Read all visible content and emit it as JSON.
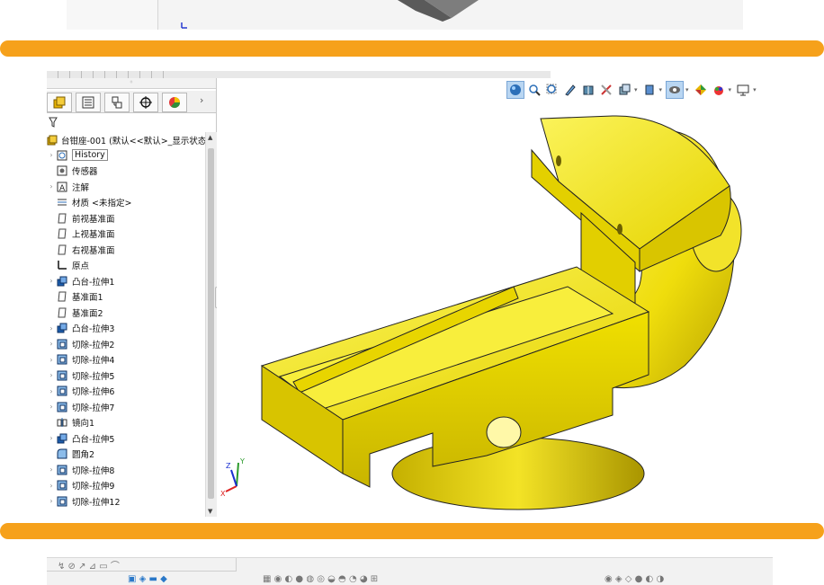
{
  "manager_tabs": [
    "feature-manager",
    "property-manager",
    "configuration-manager",
    "dimxpert-manager",
    "display-manager"
  ],
  "feature_tree": {
    "root": "台钳座-001 (默认<<默认>_显示状态 1",
    "items": [
      {
        "label": "History",
        "icon": "history-icon",
        "expandable": true,
        "boxed": true
      },
      {
        "label": "传感器",
        "icon": "sensor-icon",
        "expandable": false
      },
      {
        "label": "注解",
        "icon": "annotation-icon",
        "expandable": true
      },
      {
        "label": "材质 <未指定>",
        "icon": "material-icon",
        "expandable": false
      },
      {
        "label": "前视基准面",
        "icon": "plane-icon",
        "expandable": false
      },
      {
        "label": "上视基准面",
        "icon": "plane-icon",
        "expandable": false
      },
      {
        "label": "右视基准面",
        "icon": "plane-icon",
        "expandable": false
      },
      {
        "label": "原点",
        "icon": "origin-icon",
        "expandable": false
      },
      {
        "label": "凸台-拉伸1",
        "icon": "extrude-boss-icon",
        "expandable": true
      },
      {
        "label": "基准面1",
        "icon": "plane-icon",
        "expandable": false
      },
      {
        "label": "基准面2",
        "icon": "plane-icon",
        "expandable": false
      },
      {
        "label": "凸台-拉伸3",
        "icon": "extrude-boss-icon",
        "expandable": true
      },
      {
        "label": "切除-拉伸2",
        "icon": "extrude-cut-icon",
        "expandable": true
      },
      {
        "label": "切除-拉伸4",
        "icon": "extrude-cut-icon",
        "expandable": true
      },
      {
        "label": "切除-拉伸5",
        "icon": "extrude-cut-icon",
        "expandable": true
      },
      {
        "label": "切除-拉伸6",
        "icon": "extrude-cut-icon",
        "expandable": true
      },
      {
        "label": "切除-拉伸7",
        "icon": "extrude-cut-icon",
        "expandable": true
      },
      {
        "label": "镜向1",
        "icon": "mirror-icon",
        "expandable": false
      },
      {
        "label": "凸台-拉伸5",
        "icon": "extrude-boss-icon",
        "expandable": true
      },
      {
        "label": "圆角2",
        "icon": "fillet-icon",
        "expandable": false
      },
      {
        "label": "切除-拉伸8",
        "icon": "extrude-cut-icon",
        "expandable": true
      },
      {
        "label": "切除-拉伸9",
        "icon": "extrude-cut-icon",
        "expandable": true
      },
      {
        "label": "切除-拉伸12",
        "icon": "extrude-cut-icon",
        "expandable": true
      }
    ]
  },
  "heads_up_toolbar": [
    "zoom-to-fit-icon",
    "zoom-to-area-icon",
    "previous-view-icon",
    "section-view-icon",
    "dynamic-annotation-icon",
    "view-orientation-icon",
    "display-style-icon",
    "hide-show-icon",
    "edit-appearance-icon",
    "apply-scene-icon",
    "view-settings-icon"
  ],
  "triad_labels": {
    "x": "X",
    "y": "Y",
    "z": "Z"
  },
  "colors": {
    "accent_band": "#f6a11b",
    "model": "#f2e312",
    "model_shadow": "#b8a600",
    "selection": "#b9d6f2"
  }
}
